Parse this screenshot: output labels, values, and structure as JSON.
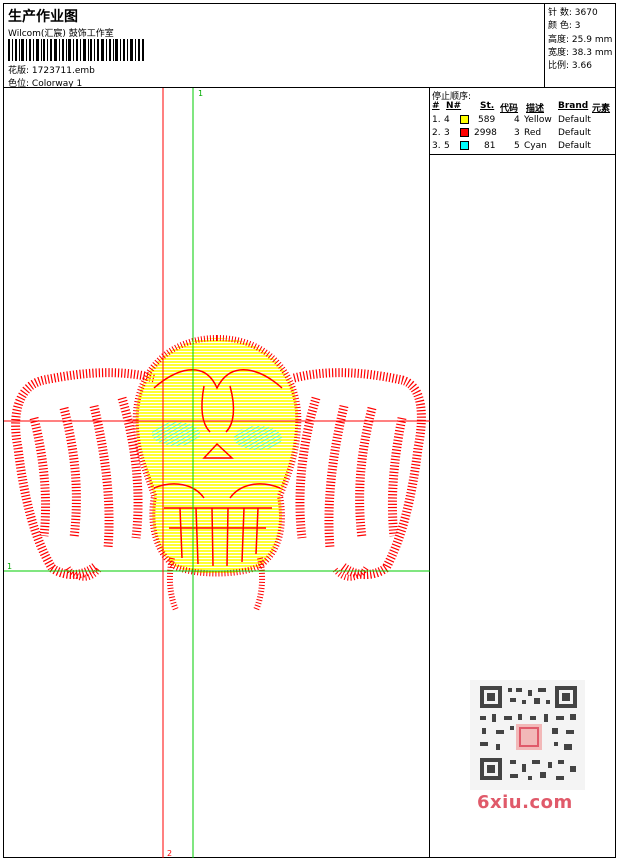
{
  "header": {
    "title": "生产作业图",
    "company": "Wilcom(汇宸) 鼓饰工作室",
    "design_label": "花版:",
    "design_value": "1723711.emb",
    "colorway_label": "色位:",
    "colorway_value": "Colorway 1"
  },
  "stats": [
    {
      "label": "针 数:",
      "value": "3670"
    },
    {
      "label": "颜 色:",
      "value": "3"
    },
    {
      "label": "高度:",
      "value": "25.9 mm"
    },
    {
      "label": "宽度:",
      "value": "38.3 mm"
    },
    {
      "label": "比例:",
      "value": "3.66"
    }
  ],
  "stop_sequence": {
    "title": "停止顺序:",
    "headers": [
      "#",
      "N#",
      "St.",
      "代码",
      "描述",
      "Brand",
      "元素"
    ],
    "rows": [
      {
        "num": "1.",
        "needle": "4",
        "color": "#ffff00",
        "stitches": "589",
        "code": "4",
        "desc": "Yellow",
        "brand": "Default"
      },
      {
        "num": "2.",
        "needle": "3",
        "color": "#ff0000",
        "stitches": "2998",
        "code": "3",
        "desc": "Red",
        "brand": "Default"
      },
      {
        "num": "3.",
        "needle": "5",
        "color": "#00ffff",
        "stitches": "81",
        "code": "5",
        "desc": "Cyan",
        "brand": "Default"
      }
    ]
  },
  "guides": {
    "v_green": "1",
    "h_green": "1",
    "v_red": "2"
  },
  "watermark": {
    "text": "6xiu.com"
  },
  "colors": {
    "red": "#ff0000",
    "yellow": "#ffff00",
    "cyan": "#00ffff",
    "green": "#00cc00"
  }
}
